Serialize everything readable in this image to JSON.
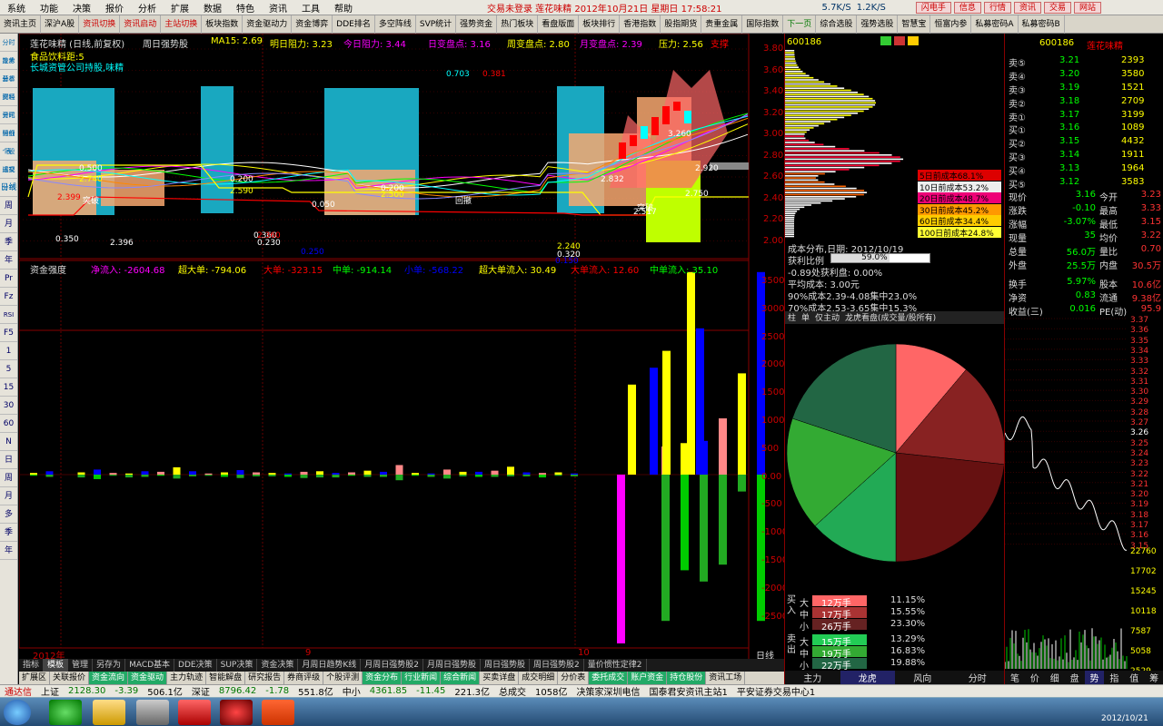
{
  "menu": {
    "items": [
      "系统",
      "功能",
      "决策",
      "报价",
      "分析",
      "扩展",
      "数据",
      "特色",
      "资讯",
      "工具",
      "帮助"
    ],
    "center_title": "交易未登录  莲花味精 2012年10月21日 星期日 17:58:21",
    "speed_up": "5.7K/S",
    "speed_down": "1.2K/S",
    "right_buttons": [
      "闪电手",
      "信息",
      "行情",
      "资讯",
      "交易",
      "网站"
    ]
  },
  "toolbar": {
    "items": [
      "资讯主页",
      "深沪A股",
      "资讯切换",
      "资讯启动",
      "主站切换",
      "板块指数",
      "资金驱动力",
      "资金博弈",
      "DDE排名",
      "多空阵线",
      "SVP统计",
      "强势资金",
      "热门板块",
      "看盘版面",
      "板块排行",
      "香港指数",
      "股指期货",
      "贵重金属",
      "国际指数",
      "下一页",
      "综合选股",
      "强势选股",
      "智慧宝",
      "恒富内参",
      "私募密码A",
      "私募密码B"
    ]
  },
  "leftbar": {
    "items": [
      "分时走势",
      "技术分析",
      "基本资料",
      "财经资讯",
      "分时明细",
      "分价表",
      "个股透视",
      "成交分布",
      "日线",
      "周",
      "月",
      "季",
      "年",
      "Pr",
      "Fz",
      "RSI",
      "F5",
      "1",
      "5",
      "15",
      "30",
      "60",
      "N",
      "日",
      "周",
      "月",
      "多",
      "季",
      "年"
    ]
  },
  "kline": {
    "stock_title": "莲花味精 (日线,前复权)",
    "indicator": "周日强势股",
    "ma_label": "MA15: 2.69",
    "tomorrow_resist": "明日阻力: 3.23",
    "today_resist": "今日阻力: 3.44",
    "day_change": "日变盘点: 3.16",
    "week_change": "周变盘点: 2.80",
    "month_change": "月变盘点: 2.39",
    "pressure": "压力: 2.56",
    "support": "支撑",
    "concept": "食品饮料距:5",
    "holder": "长城资管公司持股,味精",
    "price_labels": [
      "3.80",
      "3.60",
      "3.40",
      "3.20",
      "3.00",
      "2.80",
      "2.60",
      "2.40",
      "2.20",
      "2.00"
    ],
    "annot": [
      "0.703",
      "0.381",
      "0.500",
      "2.740",
      "2.399",
      "0.350",
      "0.360",
      "0.200",
      "2.590",
      "2.360",
      "0.230",
      "0.050",
      "0.200",
      "2.500",
      "0.320",
      "2.240",
      "3.260",
      "2.920",
      "2.832",
      "2.750",
      "2.517",
      "2.396",
      "0.150",
      "0.250"
    ],
    "tags": [
      "突破",
      "回撤",
      "突破"
    ],
    "x_labels": [
      "2012年",
      "9",
      "10"
    ],
    "period": "日线"
  },
  "fund": {
    "title": "资金强度",
    "net": "净流入: -2604.68",
    "big": "超大单: -794.06",
    "large": "大单: -323.15",
    "mid": "中单: -914.14",
    "small": "小单: -568.22",
    "big_in": "超大单流入: 30.49",
    "large_in": "大单流入: 12.60",
    "mid_in": "中单流入: 35.10",
    "axis": [
      "3500",
      "3000",
      "2500",
      "2000",
      "1500",
      "1000",
      "500",
      "0.00",
      "-500",
      "-1000",
      "-1500",
      "-2000",
      "-2500"
    ]
  },
  "tabs": {
    "items": [
      "指标",
      "模板",
      "管理",
      "另存为",
      "MACD基本",
      "DDE决策",
      "SUP决策",
      "资金决策",
      "月周日趋势K线",
      "月周日强势股2",
      "月周日强势股",
      "周日强势股",
      "周日强势股2",
      "量价惯性定律2"
    ]
  },
  "bottabs": {
    "items": [
      "扩展区",
      "关联报价",
      "资金流向",
      "资金驱动",
      "主力轨迹",
      "智能解盘",
      "研究报告",
      "券商评级",
      "个股评测",
      "资金分布",
      "行业新闻",
      "综合新闻",
      "买卖详盘",
      "成交明细",
      "分价表",
      "委托成交",
      "账户资金",
      "持仓股份",
      "资讯工场"
    ]
  },
  "chip": {
    "code": "600186",
    "cost_date": "成本分布,日期: 2012/10/19",
    "profit_ratio_label": "获利比例",
    "profit_ratio": "59.0%",
    "profit_line": "-0.89处获利盘: 0.00%",
    "avg_cost": "平均成本: 3.00元",
    "c90": "90%成本2.39-4.08集中23.0%",
    "c70": "70%成本2.53-3.65集中15.3%",
    "legend": [
      "5日前成本68.1%",
      "10日前成本53.2%",
      "20日前成本48.7%",
      "30日前成本45.2%",
      "60日前成本34.4%",
      "100日前成本24.8%"
    ],
    "tabs2": [
      "柱",
      "单",
      "仅主动",
      "龙虎看盘(成交量/股所有)"
    ],
    "bottom_tabs": [
      "主力",
      "龙虎",
      "风向",
      "分时"
    ]
  },
  "pie": {
    "slices": [
      11.15,
      15.55,
      23.3,
      13.29,
      16.83,
      19.88
    ],
    "buy_rows": [
      {
        "k": "大",
        "v": "12万手",
        "p": "11.15%"
      },
      {
        "k": "中",
        "v": "17万手",
        "p": "15.55%"
      },
      {
        "k": "小",
        "v": "26万手",
        "p": "23.30%"
      }
    ],
    "sell_rows": [
      {
        "k": "大",
        "v": "15万手",
        "p": "13.29%"
      },
      {
        "k": "中",
        "v": "19万手",
        "p": "16.83%"
      },
      {
        "k": "小",
        "v": "22万手",
        "p": "19.88%"
      }
    ],
    "buy_label": "买入",
    "sell_label": "卖出"
  },
  "quote": {
    "code": "600186",
    "name": "莲花味精",
    "asks": [
      {
        "l": "卖⑤",
        "p": "3.21",
        "v": "2393"
      },
      {
        "l": "卖④",
        "p": "3.20",
        "v": "3580"
      },
      {
        "l": "卖③",
        "p": "3.19",
        "v": "1521"
      },
      {
        "l": "卖②",
        "p": "3.18",
        "v": "2709"
      },
      {
        "l": "卖①",
        "p": "3.17",
        "v": "3199"
      }
    ],
    "bids": [
      {
        "l": "买①",
        "p": "3.16",
        "v": "1089"
      },
      {
        "l": "买②",
        "p": "3.15",
        "v": "4432"
      },
      {
        "l": "买③",
        "p": "3.14",
        "v": "1911"
      },
      {
        "l": "买④",
        "p": "3.13",
        "v": "1964"
      },
      {
        "l": "买⑤",
        "p": "3.12",
        "v": "3583"
      }
    ],
    "stats": [
      [
        "现价",
        "3.16",
        "今开",
        "3.23"
      ],
      [
        "涨跌",
        "-0.10",
        "最高",
        "3.33"
      ],
      [
        "涨幅",
        "-3.07%",
        "最低",
        "3.15"
      ],
      [
        "现量",
        "35",
        "均价",
        "3.22"
      ],
      [
        "总量",
        "56.0万",
        "量比",
        "0.70"
      ],
      [
        "外盘",
        "25.5万",
        "内盘",
        "30.5万"
      ],
      [
        "换手",
        "5.97%",
        "股本",
        "10.6亿"
      ],
      [
        "净资",
        "0.83",
        "流通",
        "9.38亿"
      ],
      [
        "收益(三)",
        "0.016",
        "PE(动)",
        "95.9"
      ]
    ],
    "mini_axis": [
      "3.37",
      "3.36",
      "3.35",
      "3.34",
      "3.33",
      "3.32",
      "3.31",
      "3.30",
      "3.29",
      "3.28",
      "3.27",
      "3.26",
      "3.25",
      "3.24",
      "3.23",
      "3.22",
      "3.21",
      "3.20",
      "3.19",
      "3.18",
      "3.17",
      "3.16",
      "3.15"
    ],
    "vol_axis": [
      "22760",
      "17702",
      "15245",
      "10118",
      "7587",
      "5058",
      "2529"
    ],
    "bottom_tabs": [
      "笔",
      "价",
      "细",
      "盘",
      "势",
      "指",
      "值",
      "筹"
    ]
  },
  "status": {
    "conn": "通达信",
    "sh": "上证",
    "sh_v": "2128.30",
    "sh_c": "-3.39",
    "sh_a": "506.1亿",
    "sz": "深证",
    "sz_v": "8796.42",
    "sz_c": "-1.78",
    "sz_a": "551.8亿",
    "zx": "中小",
    "zx_v": "4361.85",
    "zx_c": "-11.45",
    "zx_a": "221.3亿",
    "total": "总成交",
    "total_v": "1058亿",
    "server": "决策家深圳电信",
    "info": "国泰君安资讯主站1",
    "info2": "平安证券交易中心1",
    "date": "2012/10/21"
  }
}
